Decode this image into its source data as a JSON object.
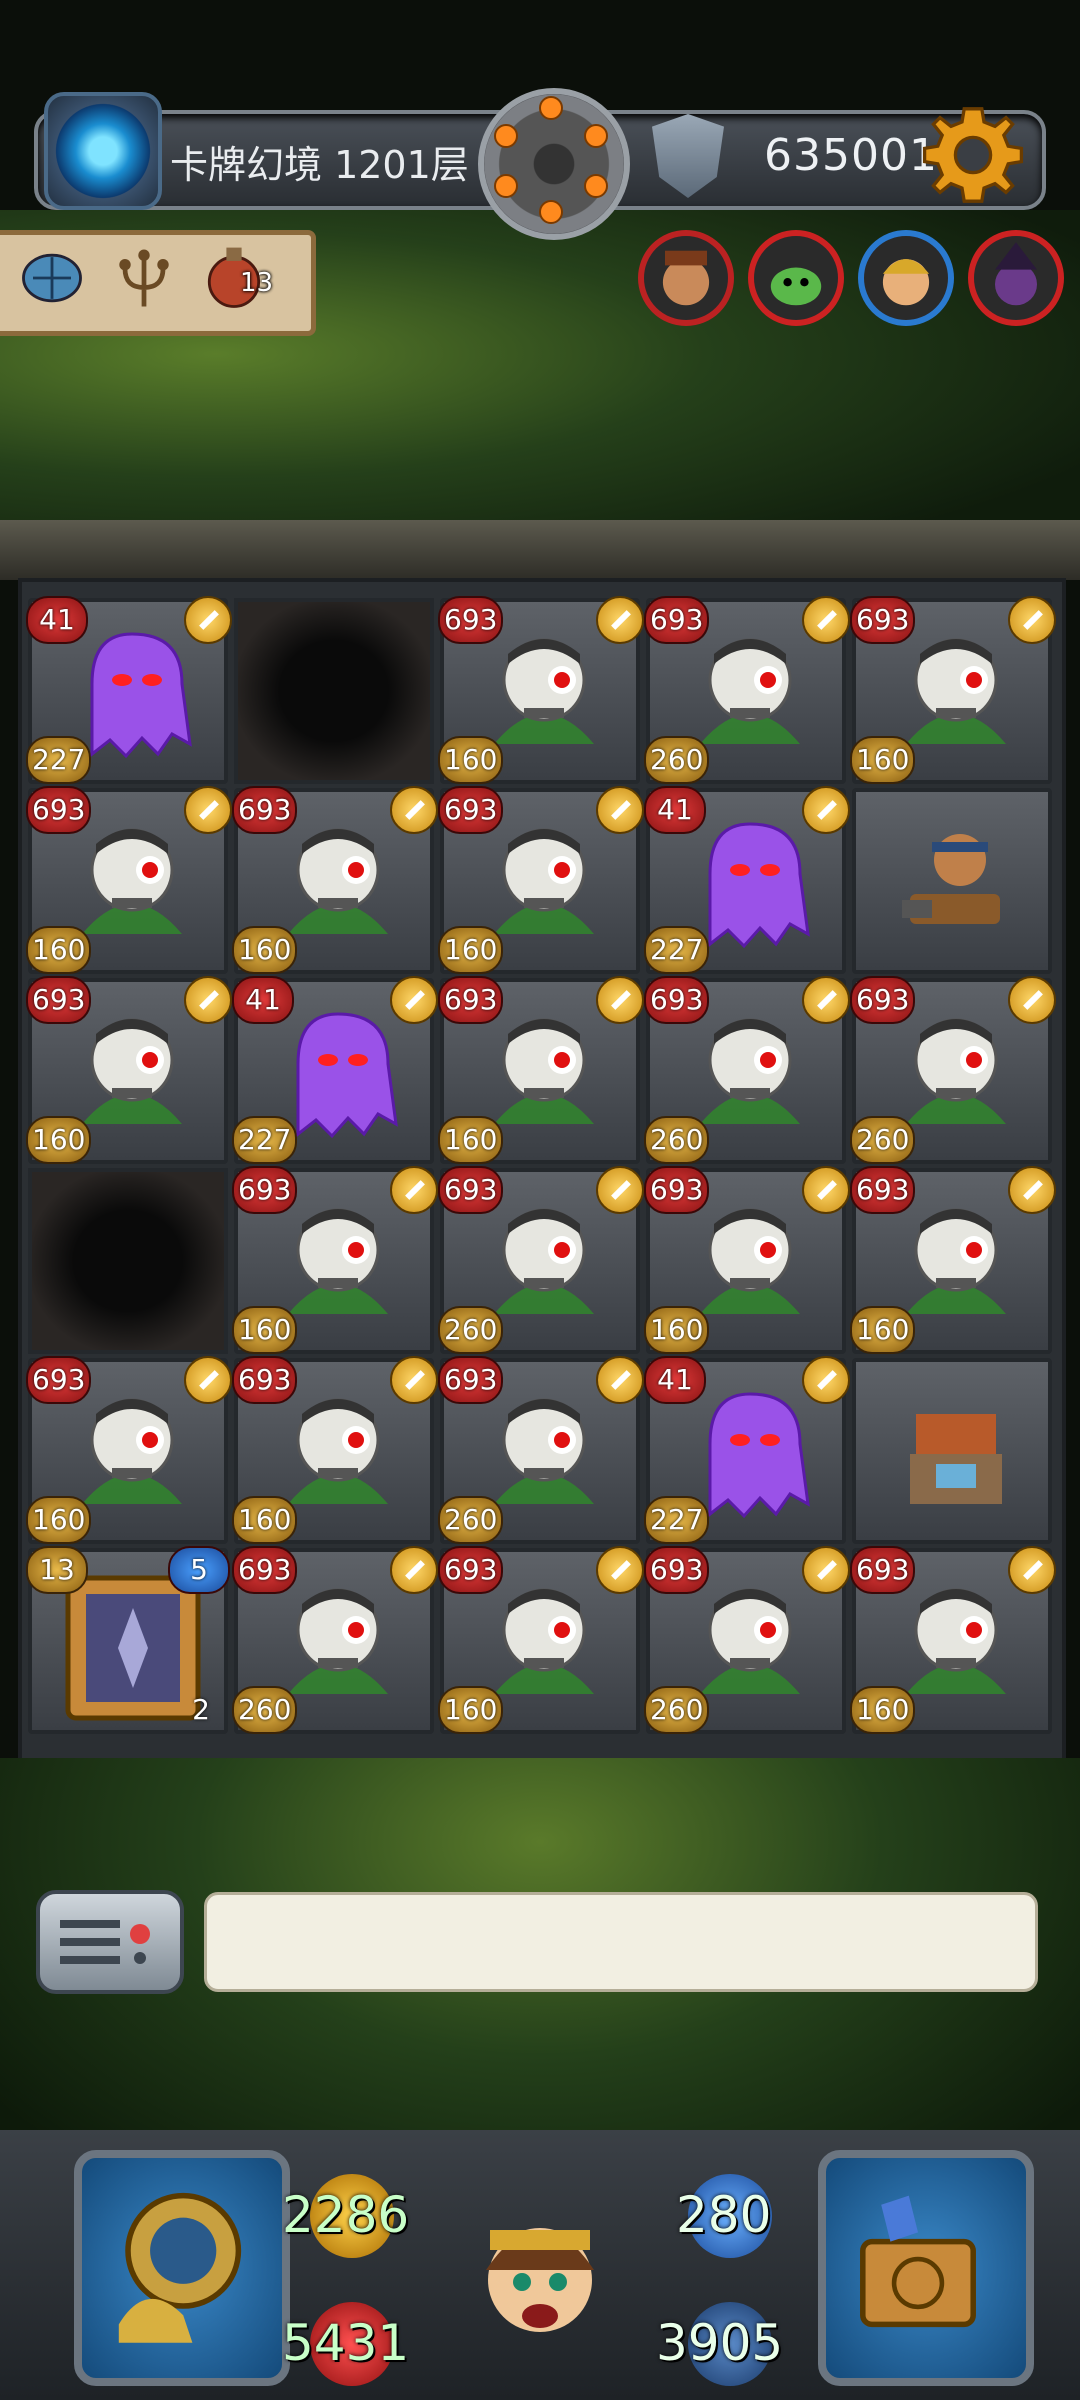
{
  "topbar": {
    "title": "卡牌幻境 1201层",
    "score": "635001"
  },
  "items": {
    "potion_count": "13"
  },
  "board": {
    "cells": [
      {
        "col": 0,
        "row": 0,
        "type": "ghost",
        "atk": "41",
        "hp": "227"
      },
      {
        "col": 1,
        "row": 0,
        "type": "hole"
      },
      {
        "col": 2,
        "row": 0,
        "type": "skeleton",
        "atk": "693",
        "hp": "160"
      },
      {
        "col": 3,
        "row": 0,
        "type": "skeleton",
        "atk": "693",
        "hp": "260"
      },
      {
        "col": 4,
        "row": 0,
        "type": "skeleton",
        "atk": "693",
        "hp": "160"
      },
      {
        "col": 0,
        "row": 1,
        "type": "skeleton",
        "atk": "693",
        "hp": "160"
      },
      {
        "col": 1,
        "row": 1,
        "type": "skeleton",
        "atk": "693",
        "hp": "160"
      },
      {
        "col": 2,
        "row": 1,
        "type": "skeleton",
        "atk": "693",
        "hp": "160"
      },
      {
        "col": 3,
        "row": 1,
        "type": "ghost",
        "atk": "41",
        "hp": "227"
      },
      {
        "col": 4,
        "row": 1,
        "type": "gunner"
      },
      {
        "col": 0,
        "row": 2,
        "type": "skeleton",
        "atk": "693",
        "hp": "160"
      },
      {
        "col": 1,
        "row": 2,
        "type": "ghost",
        "atk": "41",
        "hp": "227"
      },
      {
        "col": 2,
        "row": 2,
        "type": "skeleton",
        "atk": "693",
        "hp": "160"
      },
      {
        "col": 3,
        "row": 2,
        "type": "skeleton",
        "atk": "693",
        "hp": "260"
      },
      {
        "col": 4,
        "row": 2,
        "type": "skeleton",
        "atk": "693",
        "hp": "260"
      },
      {
        "col": 0,
        "row": 3,
        "type": "hole"
      },
      {
        "col": 1,
        "row": 3,
        "type": "skeleton",
        "atk": "693",
        "hp": "160"
      },
      {
        "col": 2,
        "row": 3,
        "type": "skeleton",
        "atk": "693",
        "hp": "260"
      },
      {
        "col": 3,
        "row": 3,
        "type": "skeleton",
        "atk": "693",
        "hp": "160"
      },
      {
        "col": 4,
        "row": 3,
        "type": "skeleton",
        "atk": "693",
        "hp": "160"
      },
      {
        "col": 0,
        "row": 4,
        "type": "skeleton",
        "atk": "693",
        "hp": "160"
      },
      {
        "col": 1,
        "row": 4,
        "type": "skeleton",
        "atk": "693",
        "hp": "160"
      },
      {
        "col": 2,
        "row": 4,
        "type": "skeleton",
        "atk": "693",
        "hp": "260"
      },
      {
        "col": 3,
        "row": 4,
        "type": "ghost",
        "atk": "41",
        "hp": "227"
      },
      {
        "col": 4,
        "row": 4,
        "type": "shop"
      },
      {
        "col": 0,
        "row": 5,
        "type": "door",
        "left_badge": "13",
        "right_badge": "5",
        "corner": "2"
      },
      {
        "col": 1,
        "row": 5,
        "type": "skeleton",
        "atk": "693",
        "hp": "260"
      },
      {
        "col": 2,
        "row": 5,
        "type": "skeleton",
        "atk": "693",
        "hp": "160"
      },
      {
        "col": 3,
        "row": 5,
        "type": "skeleton",
        "atk": "693",
        "hp": "260"
      },
      {
        "col": 4,
        "row": 5,
        "type": "skeleton",
        "atk": "693",
        "hp": "160"
      }
    ]
  },
  "hud": {
    "attack": "2286",
    "defense": "280",
    "health": "5431",
    "gold": "3905"
  },
  "chat": {
    "text": ""
  }
}
